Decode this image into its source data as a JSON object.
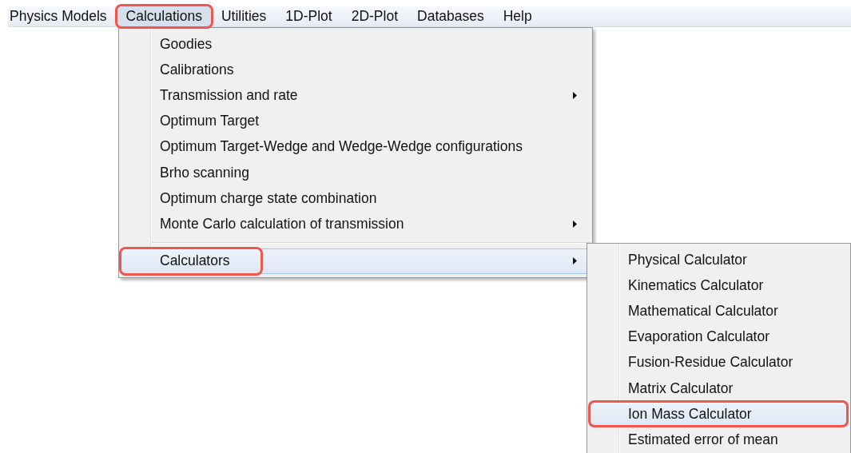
{
  "menubar": [
    {
      "label": "Physics Models",
      "selected": false,
      "annotated": false
    },
    {
      "label": "Calculations",
      "selected": true,
      "annotated": true
    },
    {
      "label": "Utilities",
      "selected": false,
      "annotated": false
    },
    {
      "label": "1D-Plot",
      "selected": false,
      "annotated": false
    },
    {
      "label": "2D-Plot",
      "selected": false,
      "annotated": false
    },
    {
      "label": "Databases",
      "selected": false,
      "annotated": false
    },
    {
      "label": "Help",
      "selected": false,
      "annotated": false
    }
  ],
  "menu": {
    "items": [
      {
        "kind": "item",
        "label": "Goodies",
        "has_submenu": false,
        "selected": false,
        "annotated": false
      },
      {
        "kind": "item",
        "label": "Calibrations",
        "has_submenu": false,
        "selected": false,
        "annotated": false
      },
      {
        "kind": "item",
        "label": "Transmission and rate",
        "has_submenu": true,
        "selected": false,
        "annotated": false
      },
      {
        "kind": "item",
        "label": "Optimum Target",
        "has_submenu": false,
        "selected": false,
        "annotated": false
      },
      {
        "kind": "item",
        "label": "Optimum Target-Wedge and Wedge-Wedge configurations",
        "has_submenu": false,
        "selected": false,
        "annotated": false
      },
      {
        "kind": "item",
        "label": "Brho scanning",
        "has_submenu": false,
        "selected": false,
        "annotated": false
      },
      {
        "kind": "item",
        "label": "Optimum charge state combination",
        "has_submenu": false,
        "selected": false,
        "annotated": false
      },
      {
        "kind": "item",
        "label": "Monte Carlo calculation of transmission",
        "has_submenu": true,
        "selected": false,
        "annotated": false
      },
      {
        "kind": "separator"
      },
      {
        "kind": "item",
        "label": "Calculators",
        "has_submenu": true,
        "selected": true,
        "annotated": true
      }
    ]
  },
  "submenu": {
    "items": [
      {
        "kind": "item",
        "label": "Physical Calculator",
        "has_submenu": false,
        "selected": false,
        "annotated": false
      },
      {
        "kind": "item",
        "label": "Kinematics Calculator",
        "has_submenu": false,
        "selected": false,
        "annotated": false
      },
      {
        "kind": "item",
        "label": "Mathematical Calculator",
        "has_submenu": false,
        "selected": false,
        "annotated": false
      },
      {
        "kind": "item",
        "label": "Evaporation Calculator",
        "has_submenu": false,
        "selected": false,
        "annotated": false
      },
      {
        "kind": "item",
        "label": "Fusion-Residue Calculator",
        "has_submenu": false,
        "selected": false,
        "annotated": false
      },
      {
        "kind": "item",
        "label": "Matrix Calculator",
        "has_submenu": false,
        "selected": false,
        "annotated": false
      },
      {
        "kind": "item",
        "label": "Ion Mass Calculator",
        "has_submenu": false,
        "selected": true,
        "annotated": true
      },
      {
        "kind": "item",
        "label": "Estimated error of mean",
        "has_submenu": false,
        "selected": false,
        "annotated": false
      }
    ]
  }
}
